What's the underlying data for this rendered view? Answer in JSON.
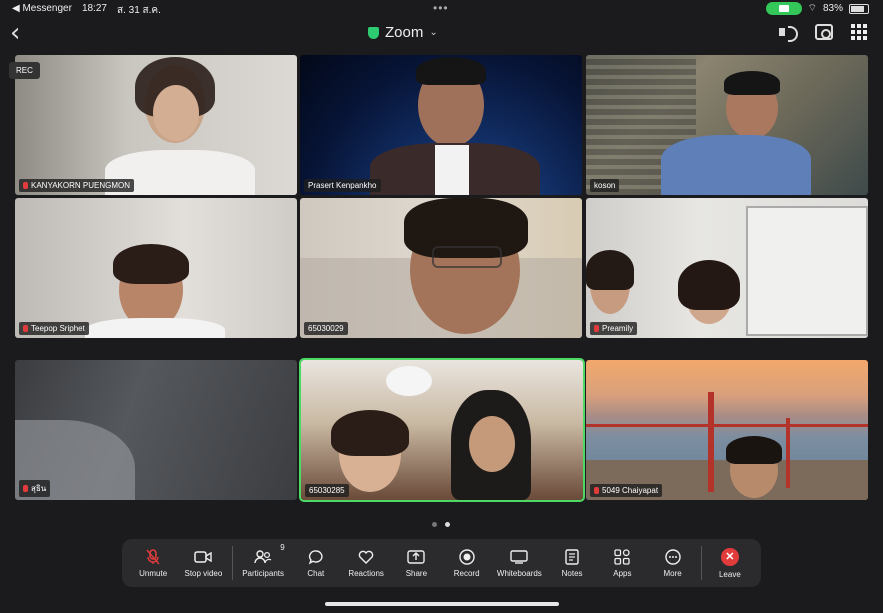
{
  "status_bar": {
    "back_app": "◀ Messenger",
    "time": "18:27",
    "date": "ส. 31 ส.ค.",
    "battery": "83%"
  },
  "header": {
    "title": "Zoom",
    "chevron": "⌄"
  },
  "recording_label": "REC",
  "participants": [
    {
      "name": "KANYAKORN PUENGMON",
      "muted": true
    },
    {
      "name": "Prasert Kenpankho",
      "muted": false
    },
    {
      "name": "koson",
      "muted": false
    },
    {
      "name": "Teepop Sriphet",
      "muted": true
    },
    {
      "name": "65030029",
      "muted": false
    },
    {
      "name": "Preamily",
      "muted": true
    },
    {
      "name": "สุธิน",
      "muted": true
    },
    {
      "name": "65030285",
      "muted": false,
      "active_speaker": true
    },
    {
      "name": "5049 Chaiyapat",
      "muted": true
    }
  ],
  "toolbar": {
    "unmute": "Unmute",
    "stop_video": "Stop video",
    "participants": "Participants",
    "participants_count": "9",
    "chat": "Chat",
    "reactions": "Reactions",
    "share": "Share",
    "record": "Record",
    "whiteboards": "Whiteboards",
    "notes": "Notes",
    "apps": "Apps",
    "more": "More",
    "leave": "Leave"
  },
  "colors": {
    "active_speaker_border": "#4cd964",
    "leave_red": "#e23b3b",
    "muted_mic_red": "#e23b3b",
    "secure_green": "#2ecc71"
  }
}
